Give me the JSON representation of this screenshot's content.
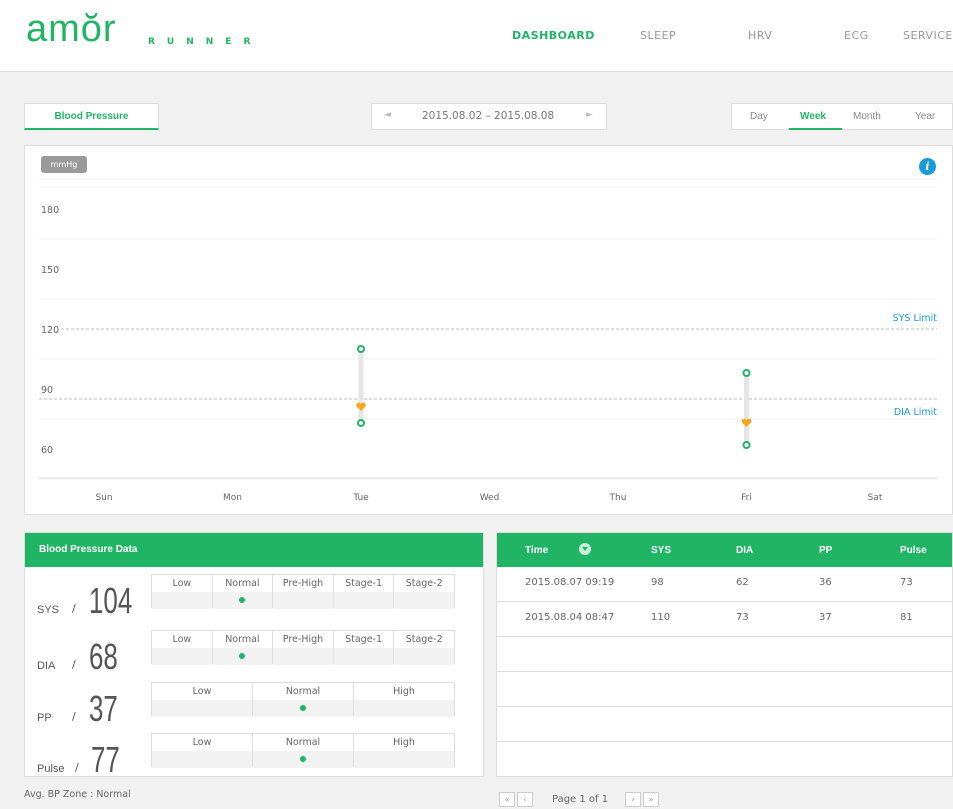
{
  "header": {
    "logo": "amŏr",
    "logo_sub": "RUNNER",
    "nav": [
      {
        "label": "DASHBOARD",
        "active": true
      },
      {
        "label": "SLEEP"
      },
      {
        "label": "HRV"
      },
      {
        "label": "ECG"
      },
      {
        "label": "SERVICE"
      }
    ]
  },
  "toolbar": {
    "tab_label": "Blood Pressure",
    "date_range": "2015.08.02 – 2015.08.08",
    "prev_icon": "triangle-left-icon",
    "next_icon": "triangle-right-icon",
    "periods": [
      "Day",
      "Week",
      "Month",
      "Year"
    ],
    "active_period": "Week"
  },
  "chart": {
    "unit": "mmHg",
    "info_icon": "i",
    "sys_limit_label": "SYS Limit",
    "dia_limit_label": "DIA Limit"
  },
  "chart_data": {
    "type": "scatter",
    "categories": [
      "Sun",
      "Mon",
      "Tue",
      "Wed",
      "Thu",
      "Fri",
      "Sat"
    ],
    "y_ticks": [
      60,
      90,
      120,
      150,
      180
    ],
    "ylim": [
      50,
      200
    ],
    "sys_limit": 120,
    "dia_limit": 85,
    "points": [
      {
        "day": "Tue",
        "sys": 110,
        "dia": 73,
        "pulse": 81
      },
      {
        "day": "Fri",
        "sys": 98,
        "dia": 62,
        "pulse": 73
      }
    ],
    "colors": {
      "sys_dia": "#1fb565",
      "pulse": "#f5a623",
      "limit": "#1a9bd7"
    }
  },
  "bp_data": {
    "title": "Blood Pressure Data",
    "metrics": [
      {
        "label": "SYS",
        "value": "104",
        "zones": [
          "Low",
          "Normal",
          "Pre-High",
          "Stage-1",
          "Stage-2"
        ],
        "active": 1
      },
      {
        "label": "DIA",
        "value": "68",
        "zones": [
          "Low",
          "Normal",
          "Pre-High",
          "Stage-1",
          "Stage-2"
        ],
        "active": 1
      },
      {
        "label": "PP",
        "value": "37",
        "zones": [
          "Low",
          "Normal",
          "High"
        ],
        "active": 1
      },
      {
        "label": "Pulse",
        "value": "77",
        "zones": [
          "Low",
          "Normal",
          "High"
        ],
        "active": 1
      }
    ],
    "avg_zone": "Avg. BP Zone : Normal"
  },
  "records": {
    "columns": [
      "Time",
      "SYS",
      "DIA",
      "PP",
      "Pulse"
    ],
    "rows": [
      [
        "2015.08.07 09:19",
        "98",
        "62",
        "36",
        "73"
      ],
      [
        "2015.08.04 08:47",
        "110",
        "73",
        "37",
        "81"
      ]
    ],
    "page_text": "Page 1 of 1",
    "first": "«",
    "prev": "‹",
    "next": "›",
    "last": "»"
  }
}
